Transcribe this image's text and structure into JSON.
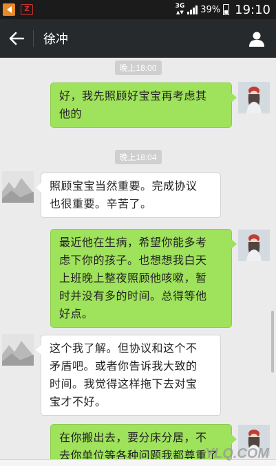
{
  "status_bar": {
    "app1_icon": "notification-app-icon",
    "app2_label": "Z",
    "network_type": "3G",
    "battery_percent": "39%",
    "time": "19:10"
  },
  "header": {
    "title": "徐冲",
    "back_icon": "back-arrow-icon",
    "profile_icon": "person-icon"
  },
  "messages": [
    {
      "type": "time",
      "text": "晚上18:00"
    },
    {
      "type": "self",
      "lines": [
        "好，我先照顾好宝宝再考虑其",
        "他的"
      ]
    },
    {
      "type": "time",
      "text": "晚上18:04"
    },
    {
      "type": "other",
      "lines": [
        "照顾宝宝当然重要。完成协议",
        "也很重要。辛苦了。"
      ]
    },
    {
      "type": "self",
      "lines": [
        "最近他在生病，希望你能多考",
        "虑下你的孩子。也想想我白天",
        "上班晚上整夜照顾他咳嗽，暂",
        "时并没有多的时间。总得等他",
        "好点。"
      ]
    },
    {
      "type": "other",
      "lines": [
        "这个我了解。但协议和这个不",
        "矛盾吧。或者你告诉我大致的",
        "时间。我觉得这样拖下去对宝",
        "宝才不好。"
      ]
    },
    {
      "type": "self",
      "lines": [
        "在你搬出去，要分床分居，不",
        "去你单位等各种问题我都尊重了"
      ]
    }
  ],
  "watermark": "YLQ.COM",
  "colors": {
    "self_bubble": "#9fe25b",
    "other_bubble": "#ffffff",
    "chat_background": "#ebebeb",
    "title_bar": "#262a2d"
  }
}
